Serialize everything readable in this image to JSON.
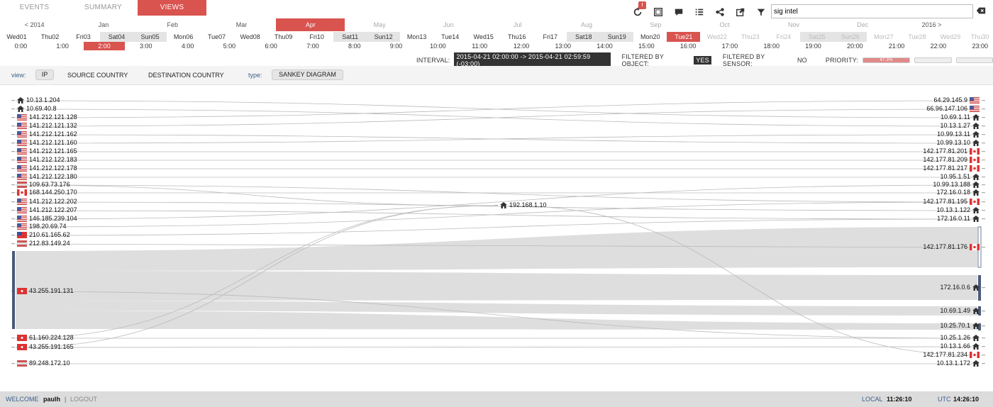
{
  "tabs": [
    {
      "label": "EVENTS"
    },
    {
      "label": "SUMMARY"
    },
    {
      "label": "VIEWS"
    }
  ],
  "toolbar": {
    "alert_badge": "!",
    "search_value": "sig intel"
  },
  "icons": [
    "refresh-icon",
    "fullscreen-icon",
    "comment-icon",
    "list-icon",
    "share-icon",
    "export-icon",
    "filter-icon",
    "clear-icon"
  ],
  "months": [
    "< 2014",
    "Jan",
    "Feb",
    "Mar",
    "Apr",
    "May",
    "Jun",
    "Jul",
    "Aug",
    "Sep",
    "Oct",
    "Nov",
    "Dec",
    "2016 >"
  ],
  "days": [
    "Wed01",
    "Thu02",
    "Fri03",
    "Sat04",
    "Sun05",
    "Mon06",
    "Tue07",
    "Wed08",
    "Thu09",
    "Fri10",
    "Sat11",
    "Sun12",
    "Mon13",
    "Tue14",
    "Wed15",
    "Thu16",
    "Fri17",
    "Sat18",
    "Sun19",
    "Mon20",
    "Tue21",
    "Wed22",
    "Thu23",
    "Fri24",
    "Sat25",
    "Sun26",
    "Mon27",
    "Tue28",
    "Wed29",
    "Thu30"
  ],
  "hours": [
    "0:00",
    "1:00",
    "2:00",
    "3:00",
    "4:00",
    "5:00",
    "6:00",
    "7:00",
    "8:00",
    "9:00",
    "10:00",
    "11:00",
    "12:00",
    "13:00",
    "14:00",
    "15:00",
    "16:00",
    "17:00",
    "18:00",
    "19:00",
    "20:00",
    "21:00",
    "22:00",
    "23:00"
  ],
  "info": {
    "interval_label": "INTERVAL:",
    "interval_value": "2015-04-21 02:00:00 -> 2015-04-21 02:59:59 (-03:00)",
    "filter_object_label": "FILTERED BY OBJECT:",
    "filter_object_value": "YES",
    "filter_sensor_label": "FILTERED BY SENSOR:",
    "filter_sensor_value": "NO",
    "priority_label": "PRIORITY:",
    "priority_values": [
      "47.3%",
      "",
      ""
    ]
  },
  "controls": {
    "view_label": "view:",
    "ip": "IP",
    "source_country": "SOURCE COUNTRY",
    "destination_country": "DESTINATION COUNTRY",
    "type_label": "type:",
    "sankey": "SANKEY DIAGRAM"
  },
  "sankey": {
    "sources": [
      {
        "ip": "10.13.1.204",
        "icon": "home-icon"
      },
      {
        "ip": "10.69.40.8",
        "icon": "home-icon"
      },
      {
        "ip": "141.212.121.128",
        "icon": "us-flag-icon"
      },
      {
        "ip": "141.212.121.132",
        "icon": "us-flag-icon"
      },
      {
        "ip": "141.212.121.162",
        "icon": "us-flag-icon"
      },
      {
        "ip": "141.212.121.160",
        "icon": "us-flag-icon"
      },
      {
        "ip": "141.212.121.165",
        "icon": "us-flag-icon"
      },
      {
        "ip": "141.212.122.183",
        "icon": "us-flag-icon"
      },
      {
        "ip": "141.212.122.178",
        "icon": "us-flag-icon"
      },
      {
        "ip": "141.212.122.180",
        "icon": "us-flag-icon"
      },
      {
        "ip": "109.63.73.176",
        "icon": "flag-icon"
      },
      {
        "ip": "168.144.250.170",
        "icon": "ca-flag-icon"
      },
      {
        "ip": "141.212.122.202",
        "icon": "us-flag-icon"
      },
      {
        "ip": "141.212.122.207",
        "icon": "us-flag-icon"
      },
      {
        "ip": "146.185.239.104",
        "icon": "us-flag-icon"
      },
      {
        "ip": "198.20.69.74",
        "icon": "us-flag-icon"
      },
      {
        "ip": "210.61.165.62",
        "icon": "tw-flag-icon"
      },
      {
        "ip": "212.83.149.24",
        "icon": "flag-icon"
      },
      {
        "ip": "43.255.191.131",
        "icon": "hk-flag-icon"
      },
      {
        "ip": "61.160.224.128",
        "icon": "cn-flag-icon"
      },
      {
        "ip": "43.255.191.165",
        "icon": "hk-flag-icon"
      },
      {
        "ip": "89.248.172.10",
        "icon": "flag-icon"
      }
    ],
    "middle": {
      "ip": "192.168.1.10",
      "icon": "home-icon"
    },
    "targets": [
      {
        "ip": "64.29.145.9",
        "icon": "us-flag-icon"
      },
      {
        "ip": "66.96.147.106",
        "icon": "us-flag-icon"
      },
      {
        "ip": "10.69.1.11",
        "icon": "home-icon"
      },
      {
        "ip": "10.13.1.27",
        "icon": "home-icon"
      },
      {
        "ip": "10.99.13.11",
        "icon": "home-icon"
      },
      {
        "ip": "10.99.13.10",
        "icon": "home-icon"
      },
      {
        "ip": "142.177.81.201",
        "icon": "ca-flag-icon"
      },
      {
        "ip": "142.177.81.209",
        "icon": "ca-flag-icon"
      },
      {
        "ip": "142.177.81.217",
        "icon": "ca-flag-icon"
      },
      {
        "ip": "10.95.1.51",
        "icon": "home-icon"
      },
      {
        "ip": "10.99.13.188",
        "icon": "home-icon"
      },
      {
        "ip": "172.16.0.18",
        "icon": "home-icon"
      },
      {
        "ip": "142.177.81.195",
        "icon": "ca-flag-icon"
      },
      {
        "ip": "10.13.1.122",
        "icon": "home-icon"
      },
      {
        "ip": "172.16.0.11",
        "icon": "home-icon"
      },
      {
        "ip": "142.177.81.176",
        "icon": "ca-flag-icon"
      },
      {
        "ip": "172.16.0.6",
        "icon": "home-icon"
      },
      {
        "ip": "10.69.1.49",
        "icon": "home-icon"
      },
      {
        "ip": "10.25.70.1",
        "icon": "home-icon"
      },
      {
        "ip": "10.25.1.26",
        "icon": "home-icon"
      },
      {
        "ip": "10.13.1.66",
        "icon": "home-icon"
      },
      {
        "ip": "142.177.81.234",
        "icon": "ca-flag-icon"
      },
      {
        "ip": "10.13.1.172",
        "icon": "home-icon"
      }
    ]
  },
  "footer": {
    "welcome": "WELCOME",
    "user": "paulh",
    "sep": "|",
    "logout": "LOGOUT",
    "local_label": "LOCAL",
    "local_time": "11:26:10",
    "utc_label": "UTC",
    "utc_time": "14:26:10"
  },
  "colors": {
    "accent": "#d9534f",
    "link": "#3a5f8a",
    "flow": "#d8d8d8",
    "node": "#4a5a7a"
  }
}
